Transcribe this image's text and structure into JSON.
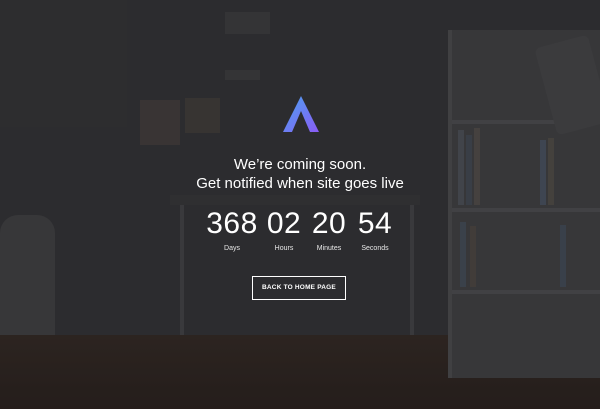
{
  "headline": {
    "line1": "We’re coming soon.",
    "line2": "Get notified when site goes live"
  },
  "countdown": [
    {
      "value": "368",
      "label": "Days"
    },
    {
      "value": "02",
      "label": "Hours"
    },
    {
      "value": "20",
      "label": "Minutes"
    },
    {
      "value": "54",
      "label": "Seconds"
    }
  ],
  "button": {
    "label": "BACK TO HOME PAGE"
  },
  "logo": {
    "icon": "letter-a-logo",
    "gradient_start": "#4aa3f0",
    "gradient_end": "#8a5cf5"
  }
}
